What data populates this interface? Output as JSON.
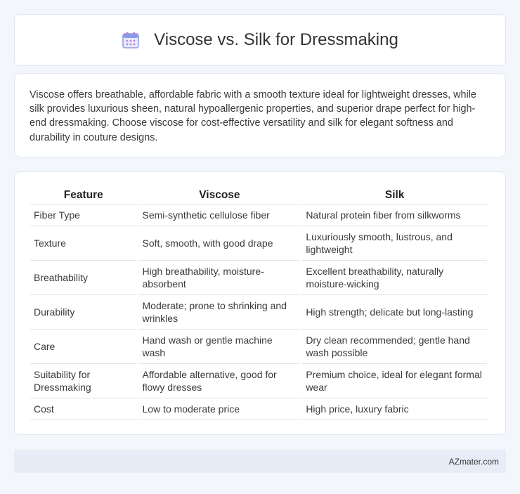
{
  "header": {
    "icon": "calendar-icon",
    "title": "Viscose vs. Silk for Dressmaking"
  },
  "summary": {
    "text": "Viscose offers breathable, affordable fabric with a smooth texture ideal for lightweight dresses, while silk provides luxurious sheen, natural hypoallergenic properties, and superior drape perfect for high-end dressmaking. Choose viscose for cost-effective versatility and silk for elegant softness and durability in couture designs."
  },
  "table": {
    "headers": [
      "Feature",
      "Viscose",
      "Silk"
    ],
    "rows": [
      [
        "Fiber Type",
        "Semi-synthetic cellulose fiber",
        "Natural protein fiber from silkworms"
      ],
      [
        "Texture",
        "Soft, smooth, with good drape",
        "Luxuriously smooth, lustrous, and lightweight"
      ],
      [
        "Breathability",
        "High breathability, moisture-absorbent",
        "Excellent breathability, naturally moisture-wicking"
      ],
      [
        "Durability",
        "Moderate; prone to shrinking and wrinkles",
        "High strength; delicate but long-lasting"
      ],
      [
        "Care",
        "Hand wash or gentle machine wash",
        "Dry clean recommended; gentle hand wash possible"
      ],
      [
        "Suitability for Dressmaking",
        "Affordable alternative, good for flowy dresses",
        "Premium choice, ideal for elegant formal wear"
      ],
      [
        "Cost",
        "Low to moderate price",
        "High price, luxury fabric"
      ]
    ]
  },
  "footer": {
    "brand": "AZmater.com"
  },
  "colors": {
    "background": "#f3f6fb",
    "footer": "#e7edf7",
    "icon_accent": "#7b8fe0"
  }
}
